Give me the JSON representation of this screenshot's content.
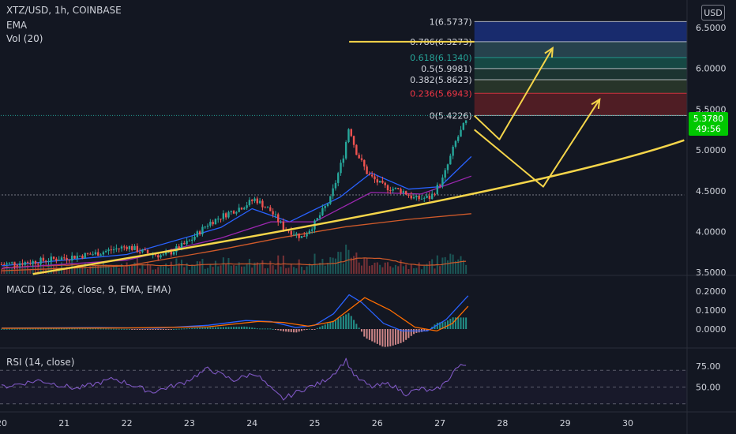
{
  "legend": {
    "symbol": "XTZ/USD, 1h, COINBASE",
    "ema": "EMA",
    "vol": "Vol (20)",
    "macd": "MACD (12, 26, close, 9, EMA, EMA)",
    "rsi": "RSI (14, close)"
  },
  "currency_button": "USD",
  "last_price": {
    "price": "5.3780",
    "countdown": "49:56"
  },
  "colors": {
    "background": "#131722",
    "up": "#26a69a",
    "down": "#ef5350",
    "last_price_box": "#00c800",
    "trend_line": "#f5d54a",
    "ema_fast": "#2962ff",
    "ema_mid": "#9c27b0",
    "ema_slow": "#d05a2a",
    "macd_line": "#2962ff",
    "signal_line": "#ff6d00",
    "rsi_line": "#7e57c2"
  },
  "chart_data": [
    {
      "type": "candlestick",
      "title": "XTZ/USD, 1h, COINBASE",
      "x_ticks": [
        "20",
        "21",
        "22",
        "23",
        "24",
        "25",
        "26",
        "27",
        "28",
        "29",
        "30"
      ],
      "y_ticks": [
        "6.5000",
        "6.0000",
        "5.5000",
        "5.0000",
        "4.5000",
        "4.0000",
        "3.5000"
      ],
      "ylim": [
        3.5,
        6.55
      ],
      "grid": false,
      "anchors": [
        {
          "d": 20.0,
          "p": 3.6
        },
        {
          "d": 20.5,
          "p": 3.63
        },
        {
          "d": 21.0,
          "p": 3.68
        },
        {
          "d": 21.5,
          "p": 3.73
        },
        {
          "d": 22.0,
          "p": 3.82
        },
        {
          "d": 22.3,
          "p": 3.74
        },
        {
          "d": 22.6,
          "p": 3.7
        },
        {
          "d": 23.0,
          "p": 3.88
        },
        {
          "d": 23.3,
          "p": 4.1
        },
        {
          "d": 23.6,
          "p": 4.22
        },
        {
          "d": 23.9,
          "p": 4.33
        },
        {
          "d": 24.05,
          "p": 4.4
        },
        {
          "d": 24.3,
          "p": 4.25
        },
        {
          "d": 24.5,
          "p": 4.05
        },
        {
          "d": 24.8,
          "p": 3.93
        },
        {
          "d": 25.0,
          "p": 4.1
        },
        {
          "d": 25.25,
          "p": 4.4
        },
        {
          "d": 25.45,
          "p": 4.9
        },
        {
          "d": 25.55,
          "p": 5.3
        },
        {
          "d": 25.65,
          "p": 5.0
        },
        {
          "d": 25.85,
          "p": 4.7
        },
        {
          "d": 26.1,
          "p": 4.55
        },
        {
          "d": 26.4,
          "p": 4.5
        },
        {
          "d": 26.6,
          "p": 4.4
        },
        {
          "d": 26.85,
          "p": 4.42
        },
        {
          "d": 27.05,
          "p": 4.65
        },
        {
          "d": 27.25,
          "p": 5.1
        },
        {
          "d": 27.38,
          "p": 5.3
        },
        {
          "d": 27.45,
          "p": 5.378
        }
      ],
      "emas": [
        {
          "name": "EMA",
          "points": [
            {
              "d": 20.0,
              "p": 3.58
            },
            {
              "d": 22.0,
              "p": 3.72
            },
            {
              "d": 23.5,
              "p": 4.05
            },
            {
              "d": 24.0,
              "p": 4.28
            },
            {
              "d": 24.6,
              "p": 4.12
            },
            {
              "d": 25.4,
              "p": 4.42
            },
            {
              "d": 25.9,
              "p": 4.72
            },
            {
              "d": 26.5,
              "p": 4.52
            },
            {
              "d": 27.0,
              "p": 4.55
            },
            {
              "d": 27.5,
              "p": 4.92
            }
          ]
        },
        {
          "name": "EMA",
          "points": [
            {
              "d": 20.0,
              "p": 3.55
            },
            {
              "d": 22.0,
              "p": 3.65
            },
            {
              "d": 23.5,
              "p": 3.92
            },
            {
              "d": 24.3,
              "p": 4.12
            },
            {
              "d": 25.0,
              "p": 4.12
            },
            {
              "d": 25.9,
              "p": 4.48
            },
            {
              "d": 26.7,
              "p": 4.46
            },
            {
              "d": 27.5,
              "p": 4.68
            }
          ]
        },
        {
          "name": "EMA",
          "points": [
            {
              "d": 20.0,
              "p": 3.52
            },
            {
              "d": 22.0,
              "p": 3.58
            },
            {
              "d": 23.5,
              "p": 3.78
            },
            {
              "d": 24.5,
              "p": 3.93
            },
            {
              "d": 25.5,
              "p": 4.06
            },
            {
              "d": 26.5,
              "p": 4.15
            },
            {
              "d": 27.5,
              "p": 4.22
            }
          ]
        }
      ],
      "fibonacci": {
        "levels": [
          {
            "ratio": 1,
            "price": 6.5737,
            "label": "1(6.5737)"
          },
          {
            "ratio": 0.786,
            "price": 6.3273,
            "label": "0.786(6.3273)"
          },
          {
            "ratio": 0.618,
            "price": 6.134,
            "label": "0.618(6.1340)"
          },
          {
            "ratio": 0.5,
            "price": 5.9981,
            "label": "0.5(5.9981)"
          },
          {
            "ratio": 0.382,
            "price": 5.8623,
            "label": "0.382(5.8623)"
          },
          {
            "ratio": 0.236,
            "price": 5.6943,
            "label": "0.236(5.6943)"
          },
          {
            "ratio": 0,
            "price": 5.4226,
            "label": "0(5.4226)"
          }
        ],
        "label_colors": [
          "#d1d4dc",
          "#d1d4dc",
          "#26a69a",
          "#d1d4dc",
          "#d1d4dc",
          "#f23645",
          "#d1d4dc"
        ],
        "zone_colors": [
          "#1a2f7a",
          "#2a4a55",
          "#17514a",
          "#1f3a34",
          "#2b3a2a",
          "#5a1f25"
        ],
        "start_day": 27.55,
        "end_day": 28.0
      },
      "horizontal_levels": [
        {
          "price": 6.3273,
          "from_day": 25.55,
          "to_day": 27.55,
          "style": "solid"
        },
        {
          "price": 5.4226,
          "from_day": 19.95,
          "to_day": 30.9,
          "style": "dotted-green"
        },
        {
          "price": 4.45,
          "from_day": 19.95,
          "to_day": 30.9,
          "style": "dotted-grey"
        }
      ],
      "trend_line": [
        {
          "d": 20.5,
          "p": 3.48
        },
        {
          "d": 28.5,
          "p": 4.55
        },
        {
          "d": 30.9,
          "p": 5.12
        }
      ],
      "projections": [
        [
          {
            "d": 27.55,
            "p": 5.42
          },
          {
            "d": 27.95,
            "p": 5.13
          },
          {
            "d": 28.8,
            "p": 6.25
          }
        ],
        [
          {
            "d": 27.55,
            "p": 5.25
          },
          {
            "d": 28.65,
            "p": 4.55
          },
          {
            "d": 29.55,
            "p": 5.62
          }
        ]
      ]
    },
    {
      "type": "line",
      "title": "MACD (12, 26, close, 9, EMA, EMA)",
      "y_ticks": [
        "0.2000",
        "0.1000",
        "0.0000"
      ],
      "ylim": [
        -0.045,
        0.215
      ],
      "series": [
        {
          "name": "MACD",
          "points": [
            {
              "d": 20.0,
              "p": 0.005
            },
            {
              "d": 21.5,
              "p": 0.008
            },
            {
              "d": 22.5,
              "p": 0.005
            },
            {
              "d": 23.3,
              "p": 0.02
            },
            {
              "d": 23.9,
              "p": 0.045
            },
            {
              "d": 24.3,
              "p": 0.04
            },
            {
              "d": 24.7,
              "p": 0.008
            },
            {
              "d": 25.0,
              "p": 0.02
            },
            {
              "d": 25.3,
              "p": 0.08
            },
            {
              "d": 25.55,
              "p": 0.18
            },
            {
              "d": 25.75,
              "p": 0.14
            },
            {
              "d": 26.1,
              "p": 0.03
            },
            {
              "d": 26.4,
              "p": -0.01
            },
            {
              "d": 26.8,
              "p": -0.01
            },
            {
              "d": 27.1,
              "p": 0.05
            },
            {
              "d": 27.45,
              "p": 0.175
            }
          ]
        },
        {
          "name": "Signal",
          "points": [
            {
              "d": 20.0,
              "p": 0.004
            },
            {
              "d": 22.0,
              "p": 0.006
            },
            {
              "d": 23.3,
              "p": 0.012
            },
            {
              "d": 24.1,
              "p": 0.04
            },
            {
              "d": 24.5,
              "p": 0.035
            },
            {
              "d": 24.9,
              "p": 0.015
            },
            {
              "d": 25.3,
              "p": 0.04
            },
            {
              "d": 25.8,
              "p": 0.165
            },
            {
              "d": 26.2,
              "p": 0.1
            },
            {
              "d": 26.6,
              "p": 0.01
            },
            {
              "d": 26.95,
              "p": -0.01
            },
            {
              "d": 27.2,
              "p": 0.03
            },
            {
              "d": 27.45,
              "p": 0.12
            }
          ]
        }
      ]
    },
    {
      "type": "line",
      "title": "RSI (14, close)",
      "y_ticks": [
        "75.00",
        "50.00"
      ],
      "ylim": [
        23,
        85
      ],
      "bands": [
        70,
        50,
        30
      ],
      "series": [
        {
          "name": "RSI",
          "points": [
            {
              "d": 20.0,
              "p": 50
            },
            {
              "d": 20.6,
              "p": 58
            },
            {
              "d": 21.2,
              "p": 48
            },
            {
              "d": 21.8,
              "p": 60
            },
            {
              "d": 22.4,
              "p": 44
            },
            {
              "d": 22.9,
              "p": 55
            },
            {
              "d": 23.3,
              "p": 72
            },
            {
              "d": 23.7,
              "p": 58
            },
            {
              "d": 24.05,
              "p": 67
            },
            {
              "d": 24.35,
              "p": 44
            },
            {
              "d": 24.5,
              "p": 36
            },
            {
              "d": 24.8,
              "p": 47
            },
            {
              "d": 25.1,
              "p": 55
            },
            {
              "d": 25.3,
              "p": 66
            },
            {
              "d": 25.5,
              "p": 82
            },
            {
              "d": 25.65,
              "p": 62
            },
            {
              "d": 25.9,
              "p": 50
            },
            {
              "d": 26.2,
              "p": 54
            },
            {
              "d": 26.45,
              "p": 42
            },
            {
              "d": 26.7,
              "p": 48
            },
            {
              "d": 26.9,
              "p": 44
            },
            {
              "d": 27.1,
              "p": 56
            },
            {
              "d": 27.25,
              "p": 72
            },
            {
              "d": 27.4,
              "p": 77
            },
            {
              "d": 27.45,
              "p": 76
            }
          ]
        }
      ]
    }
  ]
}
